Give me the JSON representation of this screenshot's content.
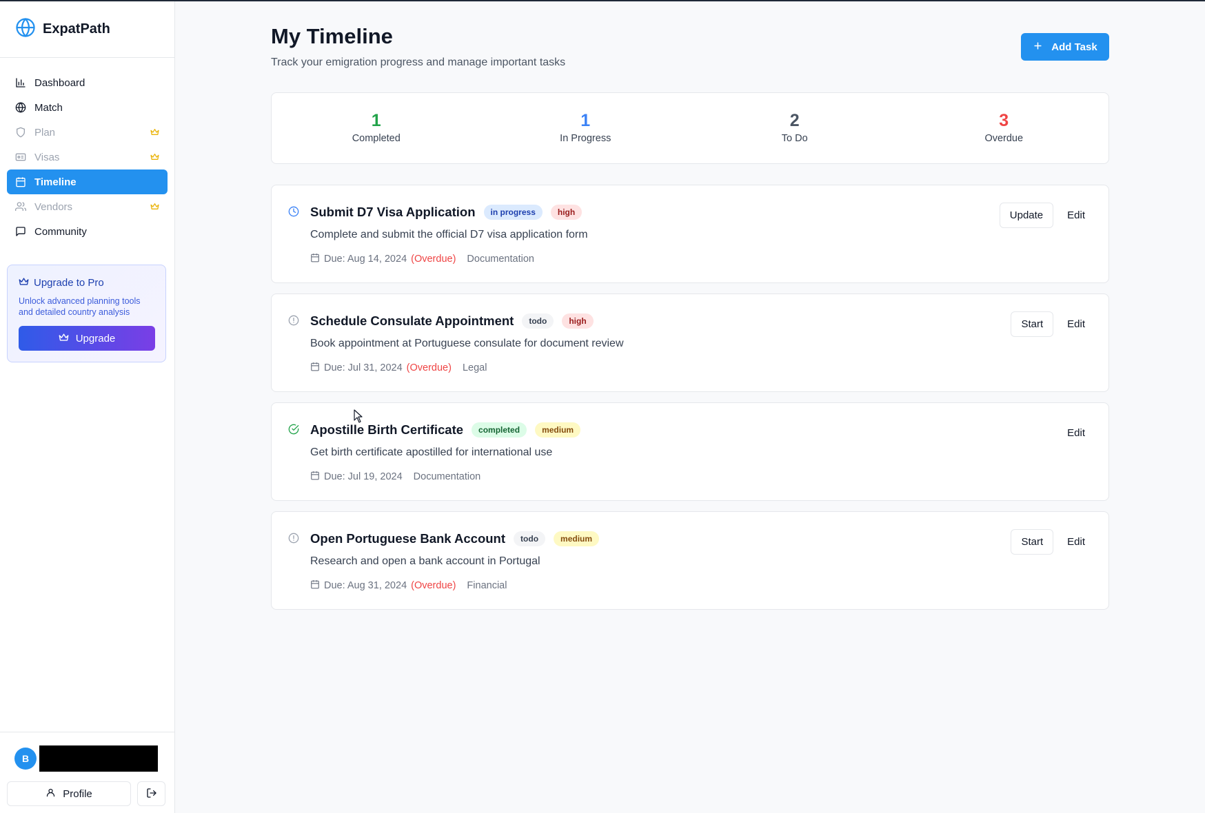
{
  "app": {
    "name": "ExpatPath"
  },
  "colors": {
    "accent": "#2391ef",
    "completed": "#22a34a",
    "in_progress": "#3b82f6",
    "todo": "#4b5563",
    "overdue": "#ef4444",
    "pro_crown": "#eab308"
  },
  "sidebar": {
    "items": [
      {
        "label": "Dashboard",
        "icon": "bar-chart-icon",
        "state": "normal",
        "pro": false
      },
      {
        "label": "Match",
        "icon": "globe-icon",
        "state": "normal",
        "pro": false
      },
      {
        "label": "Plan",
        "icon": "shield-icon",
        "state": "disabled",
        "pro": true
      },
      {
        "label": "Visas",
        "icon": "id-card-icon",
        "state": "disabled",
        "pro": true
      },
      {
        "label": "Timeline",
        "icon": "calendar-icon",
        "state": "active",
        "pro": false
      },
      {
        "label": "Vendors",
        "icon": "users-icon",
        "state": "disabled",
        "pro": true
      },
      {
        "label": "Community",
        "icon": "message-icon",
        "state": "normal",
        "pro": false
      }
    ],
    "upgrade": {
      "title": "Upgrade to Pro",
      "description": "Unlock advanced planning tools and detailed country analysis",
      "button": "Upgrade"
    },
    "user": {
      "initial": "B"
    },
    "profile_label": "Profile"
  },
  "header": {
    "title": "My Timeline",
    "subtitle": "Track your emigration progress and manage important tasks",
    "add_task_label": "Add Task"
  },
  "stats": [
    {
      "value": "1",
      "label": "Completed",
      "color": "#22a34a"
    },
    {
      "value": "1",
      "label": "In Progress",
      "color": "#3b82f6"
    },
    {
      "value": "2",
      "label": "To Do",
      "color": "#4b5563"
    },
    {
      "value": "3",
      "label": "Overdue",
      "color": "#ef4444"
    }
  ],
  "tasks": [
    {
      "title": "Submit D7 Visa Application",
      "status": "in progress",
      "priority": "high",
      "description": "Complete and submit the official D7 visa application form",
      "due": "Due: Aug 14, 2024",
      "overdue": "(Overdue)",
      "category": "Documentation",
      "actions": [
        "Update",
        "Edit"
      ]
    },
    {
      "title": "Schedule Consulate Appointment",
      "status": "todo",
      "priority": "high",
      "description": "Book appointment at Portuguese consulate for document review",
      "due": "Due: Jul 31, 2024",
      "overdue": "(Overdue)",
      "category": "Legal",
      "actions": [
        "Start",
        "Edit"
      ]
    },
    {
      "title": "Apostille Birth Certificate",
      "status": "completed",
      "priority": "medium",
      "description": "Get birth certificate apostilled for international use",
      "due": "Due: Jul 19, 2024",
      "overdue": "",
      "category": "Documentation",
      "actions": [
        "Edit"
      ]
    },
    {
      "title": "Open Portuguese Bank Account",
      "status": "todo",
      "priority": "medium",
      "description": "Research and open a bank account in Portugal",
      "due": "Due: Aug 31, 2024",
      "overdue": "(Overdue)",
      "category": "Financial",
      "actions": [
        "Start",
        "Edit"
      ]
    }
  ]
}
